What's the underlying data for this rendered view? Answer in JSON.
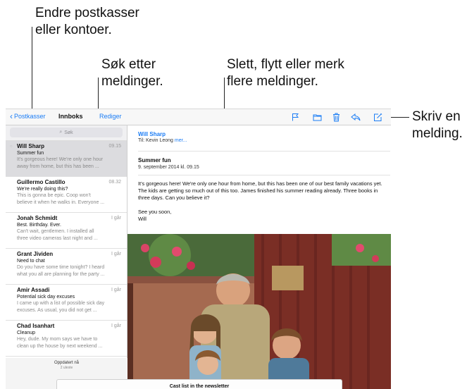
{
  "callouts": {
    "accounts": [
      "Endre postkasser",
      "eller kontoer."
    ],
    "search": [
      "Søk etter",
      "meldinger."
    ],
    "multi": [
      "Slett, flytt eller merk",
      "flere meldinger."
    ],
    "compose": [
      "Skriv en",
      "melding."
    ]
  },
  "toolbar": {
    "back_label": "Postkasser",
    "title": "Innboks",
    "edit_label": "Rediger",
    "icons": [
      "flag-icon",
      "folder-icon",
      "trash-icon",
      "reply-icon",
      "compose-icon"
    ]
  },
  "search": {
    "placeholder": "Søk"
  },
  "messages": [
    {
      "from": "Will Sharp",
      "date": "09.15",
      "subject": "Summer fun",
      "preview1": "It's gorgeous here! We're only one hour",
      "preview2": "away from home, but this has been ..."
    },
    {
      "from": "Guillermo Castillo",
      "date": "08.32",
      "subject": "We're really doing this?",
      "preview1": "This is gonna be epic. Coop won't",
      "preview2": "believe it when he walks in. Everyone ..."
    },
    {
      "from": "Jonah Schmidt",
      "date": "I går",
      "subject": "Best. Birthday. Ever.",
      "preview1": "Can't wait, gentlemen. I installed all",
      "preview2": "three video cameras last night and ..."
    },
    {
      "from": "Grant Jividen",
      "date": "I går",
      "subject": "Need to chat",
      "preview1": "Do you have some time tonight? I heard",
      "preview2": "what you all are planning for the party ..."
    },
    {
      "from": "Amir Assadi",
      "date": "I går",
      "subject": "Potential sick day excuses",
      "preview1": "I came up with a list of possible sick day",
      "preview2": "excuses. As usual, you did not get ..."
    },
    {
      "from": "Chad Isanhart",
      "date": "I går",
      "subject": "Cleanup",
      "preview1": "Hey, dude. My mom says we have to",
      "preview2": "clean up the house by next weekend ..."
    }
  ],
  "status": {
    "updated": "Oppdatert nå",
    "unread": "2 uleste"
  },
  "email": {
    "from": "Will Sharp",
    "to_prefix": "Til: Kevin Leong",
    "more": "mer...",
    "subject": "Summer fun",
    "date": "9. september 2014 kl. 09.15",
    "body": "It's gorgeous here! We're only one hour from home, but this has been one of our best family vacations yet. The kids are getting so much out of this too. James finished his summer reading already. Three books in three days. Can you believe it?",
    "signoff1": "See you soon,",
    "signoff2": "Will"
  },
  "sheet": {
    "title": "Cast list in the newsletter"
  },
  "colors": {
    "accent": "#1a7cf5",
    "selected_row": "#dcdcdf"
  }
}
